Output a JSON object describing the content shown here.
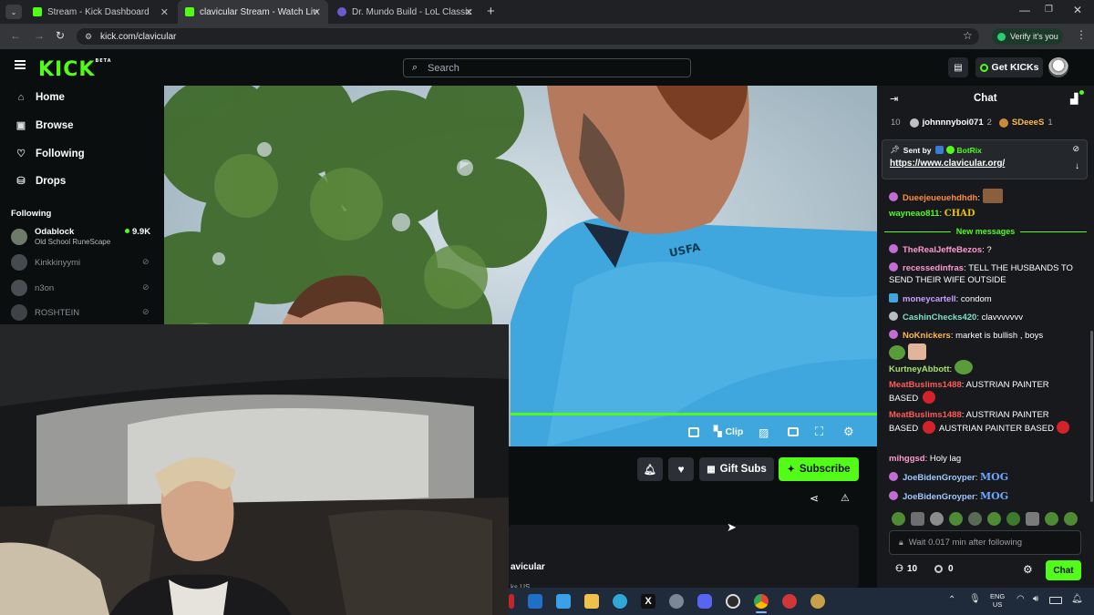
{
  "browser": {
    "tabs": [
      {
        "label": "Stream - Kick Dashboard",
        "active": false
      },
      {
        "label": "clavicular Stream - Watch Live o",
        "active": true
      },
      {
        "label": "Dr. Mundo Build - LoL Classic",
        "active": false
      }
    ],
    "url": "kick.com/clavicular",
    "verify_label": "Verify it's you"
  },
  "header": {
    "logo": "KICK",
    "logo_badge": "BETA",
    "search_placeholder": "Search",
    "get_kicks_label": "Get KICKs"
  },
  "sidebar": {
    "nav": [
      {
        "label": "Home",
        "icon": "home-icon"
      },
      {
        "label": "Browse",
        "icon": "compass-icon"
      },
      {
        "label": "Following",
        "icon": "heart-icon"
      },
      {
        "label": "Drops",
        "icon": "drops-icon"
      }
    ],
    "following_title": "Following",
    "following": [
      {
        "name": "Odablock",
        "game": "Old School RuneScape",
        "viewers": "9.9K",
        "live": true
      },
      {
        "name": "Kinkkinyymi",
        "live": false
      },
      {
        "name": "n3on",
        "live": false
      },
      {
        "name": "ROSHTEIN",
        "live": false
      }
    ]
  },
  "player": {
    "clip_label": "Clip",
    "progress": 1.0
  },
  "stream": {
    "gift_subs_label": "Gift Subs",
    "subscribe_label": "Subscribe",
    "channel_fragment": "avicular",
    "sub_fragment": "ks US"
  },
  "chat": {
    "title": "Chat",
    "leaderboard": {
      "rank": "10",
      "user1": "johnnnyboi071",
      "user1_count": "2",
      "user2": "SDeeeS",
      "user2_count": "1"
    },
    "pinned": {
      "sent_by_label": "Sent by",
      "bot": "BotRix",
      "link": "https://www.clavicular.org/"
    },
    "new_messages_label": "New messages",
    "messages": [
      {
        "user": "Dueejeueuehdhdh",
        "color": "#ff8c3a",
        "text": ""
      },
      {
        "user": "wayneao811",
        "color": "#53fc18",
        "text": ""
      },
      {
        "user": "TheRealJeffeBezos",
        "color": "#ff9ad1",
        "text": "?"
      },
      {
        "user": "recessedinfras",
        "color": "#ff9ad1",
        "text": "TELL THE HUSBANDS TO SEND THEIR WIFE OUTSIDE"
      },
      {
        "user": "moneycartell",
        "color": "#c9a0ff",
        "text": "condom"
      },
      {
        "user": "CashinChecks420",
        "color": "#7ee0c8",
        "text": "clavvvvvvv"
      },
      {
        "user": "NoKnickers",
        "color": "#ffb84d",
        "text": "market is bullish , boys"
      },
      {
        "user": "KurtneyAbbott",
        "color": "#a8e06e",
        "text": ""
      },
      {
        "user": "MeatBuslims1488",
        "color": "#ff5a5a",
        "text": "AUSTRIAN PAINTER BASED"
      },
      {
        "user": "MeatBuslims1488",
        "color": "#ff5a5a",
        "text": "AUSTRIAN PAINTER BASED"
      },
      {
        "user": "mihggsd",
        "color": "#ff9ad1",
        "text": "Holy lag"
      },
      {
        "user": "JoeBidenGroyper",
        "color": "#9ec8ff",
        "text": ""
      },
      {
        "user": "JoeBidenGroyper",
        "color": "#9ec8ff",
        "text": ""
      }
    ],
    "repeat_text": "AUSTRIAN PAINTER BASED",
    "emote_chad": "CHAD",
    "emote_mog": "MOG",
    "input_placeholder": "Wait 0.017 min after following",
    "viewer_count": "10",
    "kicks_count": "0",
    "send_label": "Chat"
  },
  "taskbar": {
    "lang_top": "ENG",
    "lang_bottom": "US"
  },
  "colors": {
    "accent": "#53fc18",
    "bg": "#0b0e0f",
    "chat_bg": "#17191c"
  }
}
